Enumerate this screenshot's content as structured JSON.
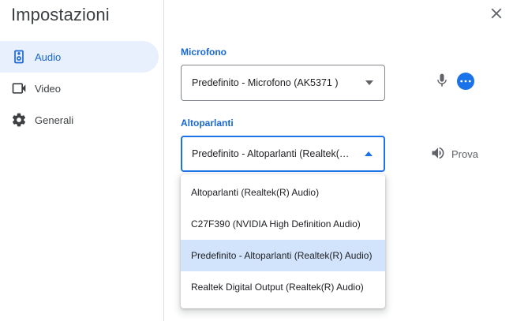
{
  "settings": {
    "title": "Impostazioni",
    "close_icon": "close-icon"
  },
  "sidebar": {
    "items": [
      {
        "label": "Audio",
        "icon": "speaker-icon",
        "active": true
      },
      {
        "label": "Video",
        "icon": "video-camera-icon",
        "active": false
      },
      {
        "label": "Generali",
        "icon": "gear-icon",
        "active": false
      }
    ]
  },
  "audio": {
    "microphone": {
      "label": "Microfono",
      "value": "Predefinito - Microfono (AK5371 )"
    },
    "speakers": {
      "label": "Altoparlanti",
      "value": "Predefinito - Altoparlanti (Realtek(R) Audio)",
      "test_label": "Prova",
      "options": [
        "Altoparlanti (Realtek(R) Audio)",
        "C27F390 (NVIDIA High Definition Audio)",
        "Predefinito - Altoparlanti (Realtek(R) Audio)",
        "Realtek Digital Output (Realtek(R) Audio)"
      ],
      "selected_index": 2
    }
  },
  "colors": {
    "accent": "#1a73e8",
    "active_nav_bg": "#e8f0fe",
    "selected_option_bg": "#d2e3fc"
  }
}
